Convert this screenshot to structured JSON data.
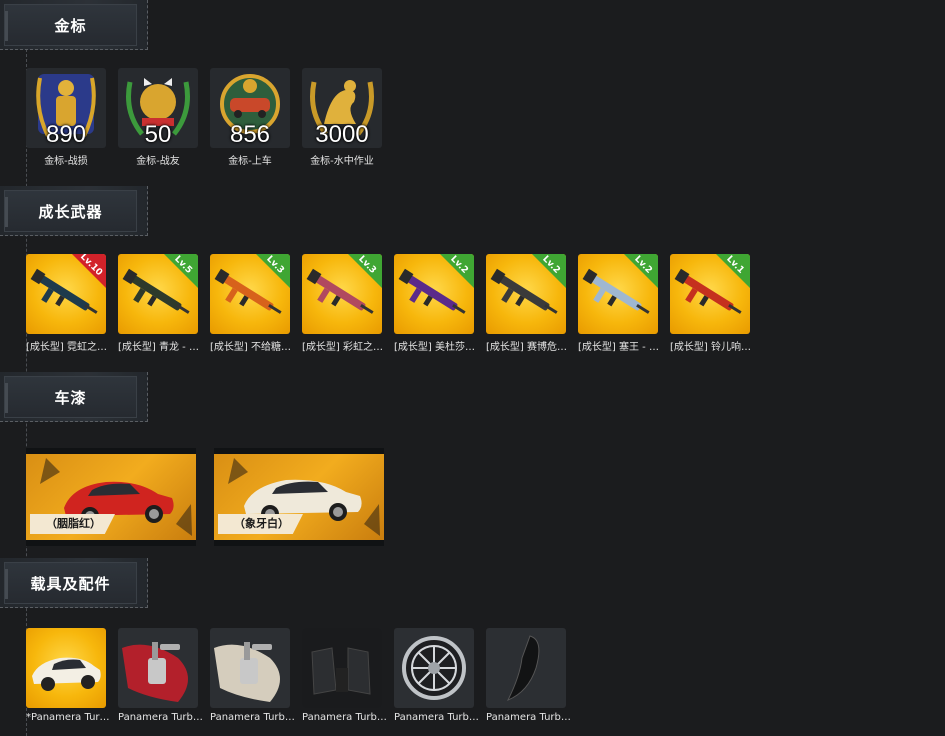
{
  "sections": {
    "medals": {
      "title": "金标",
      "items": [
        {
          "count": "890",
          "caption": "金标-战损"
        },
        {
          "count": "50",
          "caption": "金标-战友"
        },
        {
          "count": "856",
          "caption": "金标-上车"
        },
        {
          "count": "3000",
          "caption": "金标-水中作业"
        }
      ]
    },
    "weapons": {
      "title": "成长武器",
      "items": [
        {
          "level": "Lv.10",
          "caption": "[成长型] 霓虹之…",
          "ribbon": "red",
          "gun_color": "#1e3a4c"
        },
        {
          "level": "Lv.5",
          "caption": "[成长型] 青龙 - …",
          "ribbon": "green",
          "gun_color": "#2d3a2b"
        },
        {
          "level": "Lv.3",
          "caption": "[成长型] 不给糖…",
          "ribbon": "green",
          "gun_color": "#d7621b"
        },
        {
          "level": "Lv.3",
          "caption": "[成长型] 彩虹之…",
          "ribbon": "green",
          "gun_color": "#b0495f"
        },
        {
          "level": "Lv.2",
          "caption": "[成长型] 美杜莎…",
          "ribbon": "green",
          "gun_color": "#5b2a8a"
        },
        {
          "level": "Lv.2",
          "caption": "[成长型] 赛博危…",
          "ribbon": "green",
          "gun_color": "#3a3a3a"
        },
        {
          "level": "Lv.2",
          "caption": "[成长型] 塞王 - …",
          "ribbon": "green",
          "gun_color": "#9fb7d0"
        },
        {
          "level": "Lv.1",
          "caption": "[成长型] 铃儿响…",
          "ribbon": "green",
          "gun_color": "#c5301e"
        }
      ]
    },
    "paints": {
      "title": "车漆",
      "items": [
        {
          "label": "（胭脂红）",
          "car_color": "#d0241f"
        },
        {
          "label": "（象牙白）",
          "car_color": "#efe9da"
        }
      ]
    },
    "vehicles": {
      "title": "载具及配件",
      "items": [
        {
          "caption": "*Panamera Tur…",
          "icon": "car-icon"
        },
        {
          "caption": "Panamera Turb…",
          "icon": "spray-gun-red-icon"
        },
        {
          "caption": "Panamera Turb…",
          "icon": "spray-gun-white-icon"
        },
        {
          "caption": "Panamera Turb…",
          "icon": "car-seat-icon"
        },
        {
          "caption": "Panamera Turb…",
          "icon": "wheel-rim-icon"
        },
        {
          "caption": "Panamera Turb…",
          "icon": "spoiler-icon"
        }
      ]
    }
  }
}
